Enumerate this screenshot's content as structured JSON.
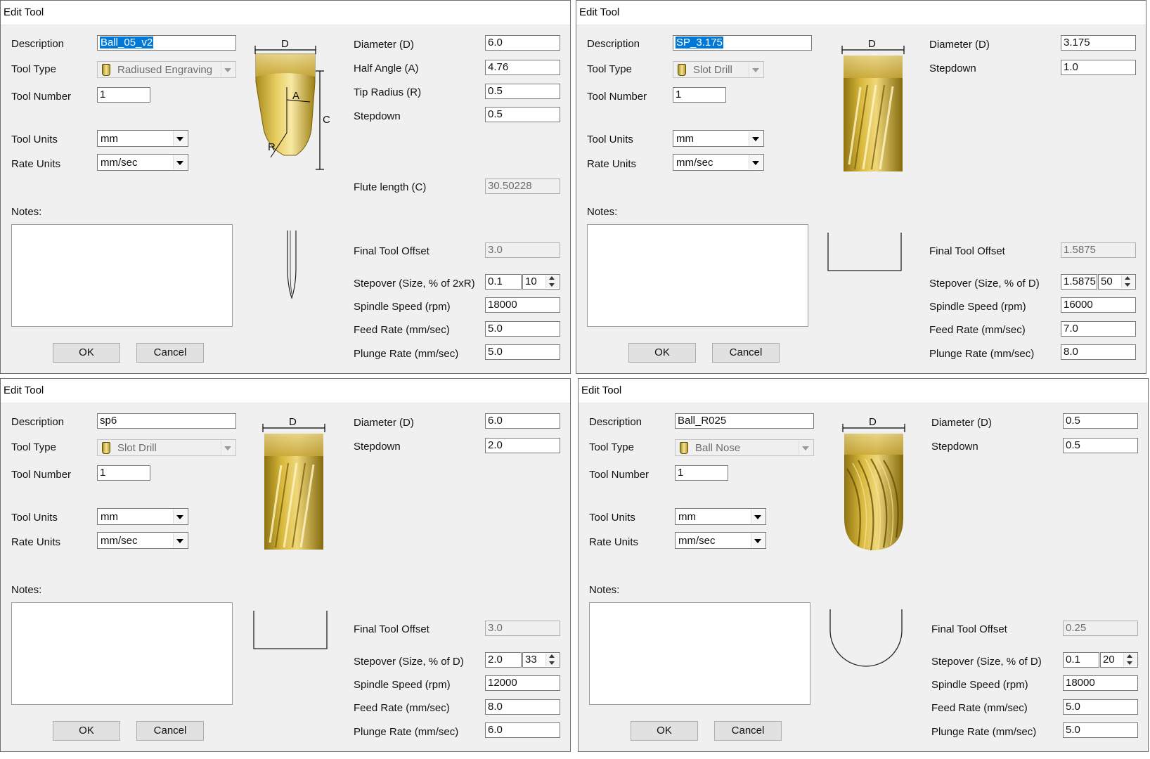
{
  "labels": {
    "title": "Edit Tool",
    "description": "Description",
    "tool_type": "Tool Type",
    "tool_number": "Tool Number",
    "tool_units": "Tool Units",
    "rate_units": "Rate Units",
    "notes": "Notes:",
    "ok": "OK",
    "cancel": "Cancel",
    "diameter": "Diameter (D)",
    "half_angle": "Half Angle (A)",
    "tip_radius": "Tip Radius (R)",
    "stepdown": "Stepdown",
    "flute_length": "Flute length (C)",
    "final_tool_offset": "Final Tool Offset",
    "stepover_2xr": "Stepover (Size, % of 2xR)",
    "stepover_d": "Stepover (Size, % of D)",
    "spindle_speed": "Spindle Speed (rpm)",
    "feed_rate": "Feed Rate (mm/sec)",
    "plunge_rate": "Plunge Rate (mm/sec)"
  },
  "diagram_letters": {
    "d": "D",
    "a": "A",
    "c": "C",
    "r": "R"
  },
  "colors": {
    "selection": "#0078d7",
    "tool_gold": "#d8b63c",
    "window_bg": "#f0f0f0"
  },
  "dialogs": [
    {
      "description": "Ball_05_v2",
      "tool_type": "Radiused Engraving",
      "tool_number": "1",
      "tool_units": "mm",
      "rate_units": "mm/sec",
      "diameter": "6.0",
      "half_angle": "4.76",
      "tip_radius": "0.5",
      "stepdown": "0.5",
      "flute_length": "30.50228",
      "final_tool_offset": "3.0",
      "stepover_size": "0.1",
      "stepover_percent": "10",
      "spindle_speed": "18000",
      "feed_rate": "5.0",
      "plunge_rate": "5.0"
    },
    {
      "description": "SP_3.175",
      "tool_type": "Slot Drill",
      "tool_number": "1",
      "tool_units": "mm",
      "rate_units": "mm/sec",
      "diameter": "3.175",
      "stepdown": "1.0",
      "final_tool_offset": "1.5875",
      "stepover_size": "1.5875",
      "stepover_percent": "50",
      "spindle_speed": "16000",
      "feed_rate": "7.0",
      "plunge_rate": "8.0"
    },
    {
      "description": "sp6",
      "tool_type": "Slot Drill",
      "tool_number": "1",
      "tool_units": "mm",
      "rate_units": "mm/sec",
      "diameter": "6.0",
      "stepdown": "2.0",
      "final_tool_offset": "3.0",
      "stepover_size": "2.0",
      "stepover_percent": "33",
      "spindle_speed": "12000",
      "feed_rate": "8.0",
      "plunge_rate": "6.0"
    },
    {
      "description": "Ball_R025",
      "tool_type": "Ball Nose",
      "tool_number": "1",
      "tool_units": "mm",
      "rate_units": "mm/sec",
      "diameter": "0.5",
      "stepdown": "0.5",
      "final_tool_offset": "0.25",
      "stepover_size": "0.1",
      "stepover_percent": "20",
      "spindle_speed": "18000",
      "feed_rate": "5.0",
      "plunge_rate": "5.0"
    }
  ]
}
